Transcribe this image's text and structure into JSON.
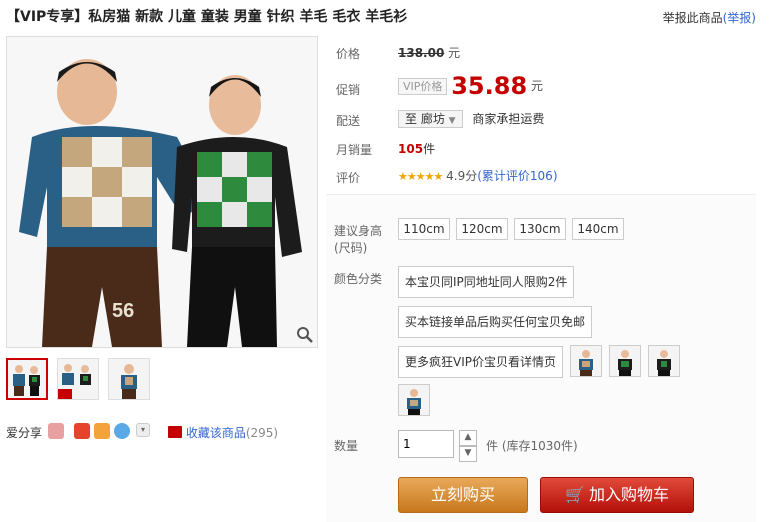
{
  "title": "【VIP专享】私房猫 新款 儿童 童装 男童 针织 羊毛 毛衣 羊毛衫",
  "report": {
    "text": "举报此商品",
    "link": "(举报)"
  },
  "price": {
    "label": "价格",
    "original": "138.00",
    "unit": "元"
  },
  "promo": {
    "label": "促销",
    "tag": "VIP价格",
    "value": "35.88",
    "unit": "元"
  },
  "shipping": {
    "label": "配送",
    "destination": "至 廊坊",
    "note": "商家承担运费"
  },
  "sales": {
    "label": "月销量",
    "count": "105",
    "unit": "件"
  },
  "rating": {
    "label": "评价",
    "stars": 5,
    "score": "4.9分",
    "reviews": "(累计评价106)"
  },
  "size": {
    "label": "建议身高(尺码)",
    "options": [
      "110cm",
      "120cm",
      "130cm",
      "140cm"
    ]
  },
  "color": {
    "label": "颜色分类",
    "options": [
      "本宝贝同IP同地址同人限购2件",
      "买本链接单品后购买任何宝贝免邮",
      "更多疯狂VIP价宝贝看详情页"
    ]
  },
  "quantity": {
    "label": "数量",
    "value": "1",
    "stock": "件 (库存1030件)"
  },
  "buttons": {
    "buy": "立刻购买",
    "cart": "加入购物车"
  },
  "share": {
    "label": "爱分享"
  },
  "favorite": {
    "label": "收藏该商品",
    "count": "(295)"
  },
  "thumbnails": [
    "thumb-1",
    "thumb-2",
    "thumb-3"
  ],
  "colors": {
    "price_red": "#c40000",
    "link_blue": "#3366cc",
    "buy_orange": "#d98a2e",
    "cart_red": "#c81e14"
  }
}
